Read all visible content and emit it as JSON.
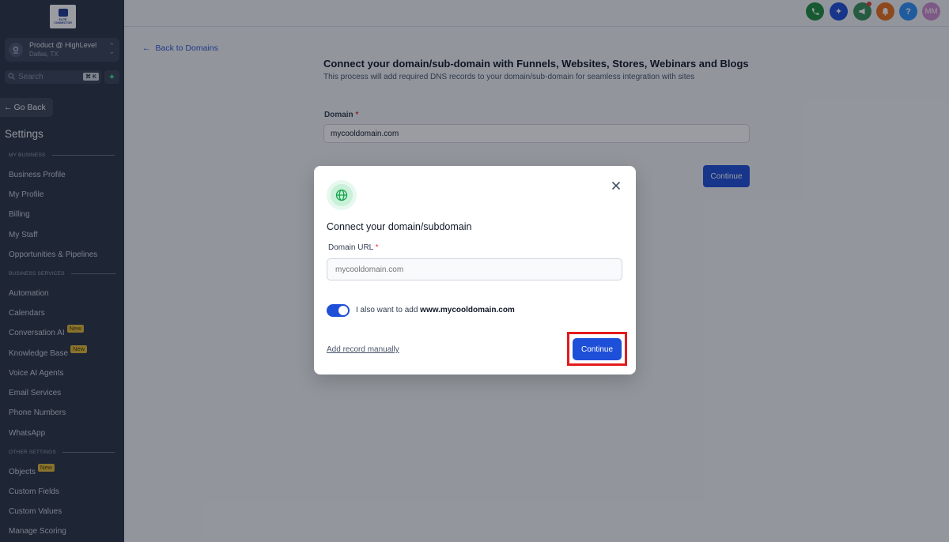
{
  "sidebar": {
    "logo_text": "ELITE CONNECTOR",
    "account": {
      "name": "Product @ HighLevel",
      "location": "Dallas, TX"
    },
    "search": {
      "placeholder": "Search",
      "shortcut": "⌘ K"
    },
    "go_back_label": "Go Back",
    "settings_title": "Settings",
    "sections": [
      {
        "label": "MY BUSINESS",
        "items": [
          "Business Profile",
          "My Profile",
          "Billing",
          "My Staff",
          "Opportunities & Pipelines"
        ]
      },
      {
        "label": "BUSINESS SERVICES",
        "items": [
          "Automation",
          "Calendars",
          "Conversation AI",
          "Knowledge Base",
          "Voice AI Agents",
          "Email Services",
          "Phone Numbers",
          "WhatsApp"
        ]
      },
      {
        "label": "OTHER SETTINGS",
        "items": [
          "Objects",
          "Custom Fields",
          "Custom Values",
          "Manage Scoring"
        ]
      }
    ],
    "new_badge": "New"
  },
  "topbar": {
    "icons": [
      {
        "name": "phone-icon",
        "color": "#1e8e3e"
      },
      {
        "name": "magic-icon",
        "color": "#1e4fd8"
      },
      {
        "name": "megaphone-icon",
        "color": "#3a8f5a"
      },
      {
        "name": "bell-icon",
        "color": "#e8711c"
      },
      {
        "name": "help-icon",
        "color": "#2e90fa"
      }
    ],
    "avatar_initials": "MM"
  },
  "main": {
    "back_link": "Back to Domains",
    "title": "Connect your domain/sub-domain with Funnels, Websites, Stores, Webinars and Blogs",
    "subtitle": "This process will add required DNS records to your domain/sub-domain for seamless integration with sites",
    "domain_label": "Domain",
    "domain_value": "mycooldomain.com",
    "continue_label": "Continue"
  },
  "modal": {
    "title": "Connect your domain/subdomain",
    "url_label": "Domain URL",
    "url_placeholder": "mycooldomain.com",
    "toggle_on": true,
    "toggle_prefix": "I also want to add ",
    "toggle_domain": "www.mycooldomain.com",
    "manual_link": "Add record manually",
    "continue_label": "Continue"
  },
  "colors": {
    "accent": "#1e4fd8",
    "sidebar": "#2a3345",
    "badge": "#e0b737",
    "highlight": "#e31b1b"
  }
}
